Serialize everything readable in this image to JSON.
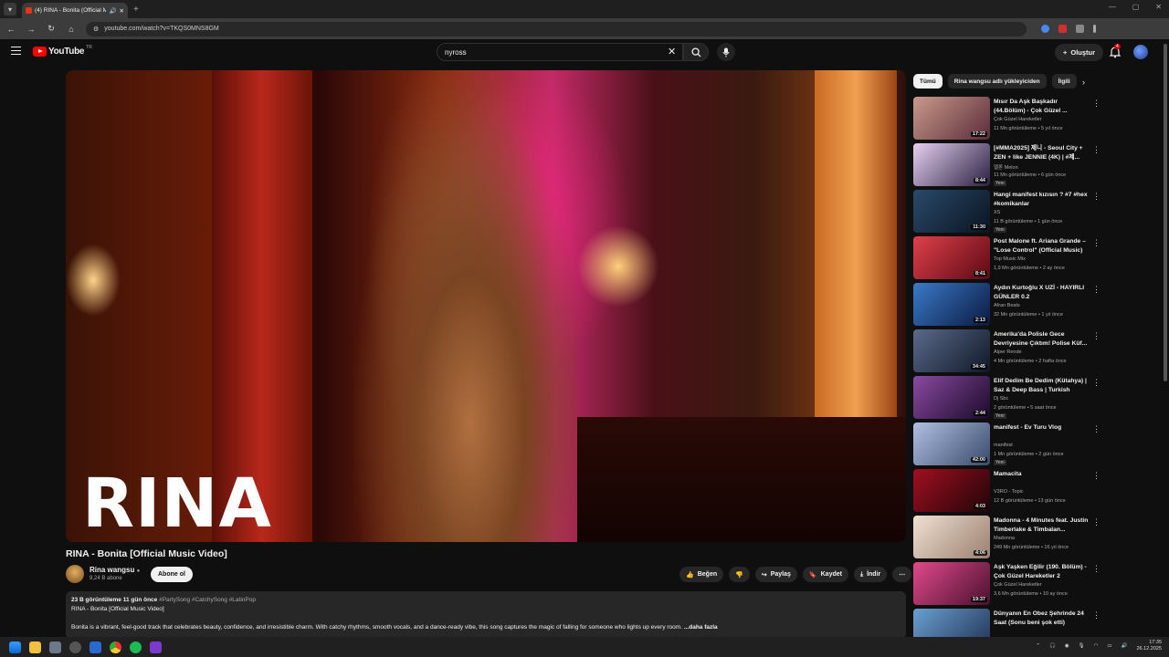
{
  "browser": {
    "tab_title": "(4) RINA - Bonita (Official M",
    "url": "youtube.com/watch?v=TKQS0MNS8GM"
  },
  "header": {
    "logo": "YouTube",
    "logo_country": "TR",
    "search_value": "nyross",
    "create_label": "Oluştur",
    "notif_count": "4"
  },
  "video": {
    "overlay_text": "RINA",
    "title": "RINA - Bonita [Official Music Video]",
    "channel": "Rina wangsu",
    "subs": "9,24 B abone",
    "subscribe": "Abone ol",
    "like": "Beğen",
    "share": "Paylaş",
    "save": "Kaydet",
    "download": "İndir",
    "desc_stats": "23 B görüntüleme  11 gün önce",
    "desc_tags": "#PartySong #CatchySong #LatinPop",
    "desc_line2": "RINA - Bonita [Official Music Video]",
    "desc_line3": "Bonita is a vibrant, feel-good track that celebrates beauty, confidence, and irresistible charm. With catchy rhythms, smooth vocals, and a dance-ready vibe, this song captures the magic of falling for someone who lights up every room.",
    "more": "...daha fazla"
  },
  "chips": [
    "Tümü",
    "Rina wangsu adlı yükleyiciden",
    "İlgili"
  ],
  "recs": [
    {
      "title": "Mısır Da Aşk Başkadır (44.Bölüm) - Çok Güzel ...",
      "channel": "Çok Güzel Hareketler",
      "meta": "11 Mn görüntüleme • 5 yıl önce",
      "dur": "17:22",
      "new": "",
      "c1": "#c99a8a",
      "c2": "#5a2c3a"
    },
    {
      "title": "[#MMA2025] 제니 - Seoul City + ZEN + like JENNIE  (4K) | #제...",
      "channel": "멜론 Melon",
      "meta": "11 Mn görüntüleme • 6 gün önce",
      "dur": "8:44",
      "new": "Yeni",
      "c1": "#e6d0f0",
      "c2": "#2a2040"
    },
    {
      "title": "Hangi manifest kızısın ? #7 #hex #komikanlar",
      "channel": "XS",
      "meta": "11 B görüntüleme • 1 gün önce",
      "dur": "11:30",
      "new": "Yeni",
      "c1": "#2a4a6a",
      "c2": "#0a1420"
    },
    {
      "title": "Post Malone ft. Ariana Grande – \"Lose Control\" (Official Music)",
      "channel": "Top Music Mix",
      "meta": "1,9 Mn görüntüleme • 2 ay önce",
      "dur": "8:41",
      "new": "",
      "c1": "#e0404a",
      "c2": "#5a0a14"
    },
    {
      "title": "Aydın Kurtoğlu X UZİ - HAYIRLI GÜNLER 0.2",
      "channel": "Afran Beats",
      "meta": "32 Mn görüntüleme • 1 yıl önce",
      "dur": "2:13",
      "new": "",
      "c1": "#3a7ac8",
      "c2": "#0a1a40"
    },
    {
      "title": "Amerika'da Polisle Gece Devriyesine Çıktım! Polise Küf...",
      "channel": "Alper Rende",
      "meta": "4 Mn görüntüleme • 2 hafta önce",
      "dur": "34:45",
      "new": "",
      "c1": "#5a6a8a",
      "c2": "#101828"
    },
    {
      "title": "Elif Dedim Be Dedim (Kütahya) | Saz & Deep Bass | Turkish Folk...",
      "channel": "Dj Sbc",
      "meta": "2 görüntüleme • 5 saat önce",
      "dur": "2:44",
      "new": "Yeni",
      "c1": "#8a4aa0",
      "c2": "#1a0a2a"
    },
    {
      "title": "manifest - Ev Turu Vlog",
      "channel": "manifest",
      "meta": "1 Mn görüntüleme • 2 gün önce",
      "dur": "42:00",
      "new": "Yeni",
      "c1": "#b0c0e0",
      "c2": "#3a4a6a"
    },
    {
      "title": "Mamacita",
      "channel": "V3RO - Topic",
      "meta": "12 B görüntüleme • 13 gün önce",
      "dur": "4:03",
      "new": "",
      "c1": "#a01020",
      "c2": "#200408"
    },
    {
      "title": "Madonna - 4 Minutes feat. Justin Timberlake & Timbalan...",
      "channel": "Madonna",
      "meta": "249 Mn görüntüleme • 16 yıl önce",
      "dur": "4:06",
      "new": "",
      "c1": "#f0e0d0",
      "c2": "#9a8070"
    },
    {
      "title": "Aşk Yaşken Eğilir (190. Bölüm) - Çok Güzel Hareketler 2",
      "channel": "Çok Güzel Hareketler",
      "meta": "3,6 Mn görüntüleme • 10 ay önce",
      "dur": "19:37",
      "new": "",
      "c1": "#e04a8a",
      "c2": "#4a1030"
    },
    {
      "title": "Dünyanın En Obez Şehrinde 24 Saat (Sonu beni şok etti)",
      "channel": "",
      "meta": "",
      "dur": "",
      "new": "",
      "c1": "#6aa0d0",
      "c2": "#203050"
    }
  ],
  "taskbar": {
    "time": "17:35",
    "date": "26.12.2025"
  }
}
